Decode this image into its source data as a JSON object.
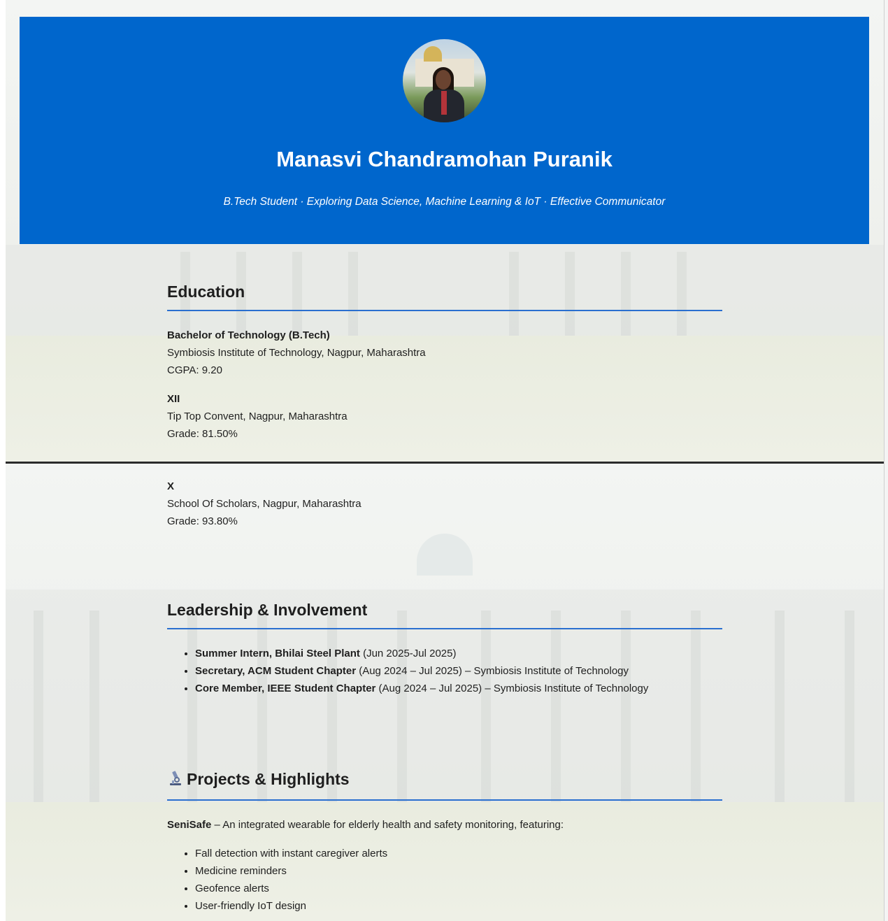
{
  "colors": {
    "hero_bg": "#0066cc",
    "section_rule": "#2a6fcf",
    "text": "#1f1f1f"
  },
  "hero": {
    "name": "Manasvi Chandramohan Puranik",
    "tagline": "B.Tech Student · Exploring Data Science, Machine Learning & IoT · Effective Communicator",
    "avatar_icon": "profile-photo"
  },
  "education": {
    "title": "Education",
    "entries": [
      {
        "degree": "Bachelor of Technology (B.Tech)",
        "institution": "Symbiosis Institute of Technology, Nagpur, Maharashtra",
        "score": "CGPA: 9.20"
      },
      {
        "degree": "XII",
        "institution": "Tip Top Convent, Nagpur, Maharashtra",
        "score": "Grade: 81.50%"
      },
      {
        "degree": "X",
        "institution": "School Of Scholars, Nagpur, Maharashtra",
        "score": "Grade: 93.80%"
      }
    ]
  },
  "leadership": {
    "title": "Leadership & Involvement",
    "items": [
      {
        "role": "Summer Intern, Bhilai Steel Plant",
        "detail": " (Jun 2025-Jul 2025)"
      },
      {
        "role": "Secretary, ACM Student Chapter",
        "detail": " (Aug 2024 – Jul 2025) – Symbiosis Institute of Technology"
      },
      {
        "role": "Core Member, IEEE Student Chapter",
        "detail": " (Aug 2024 – Jul 2025) – Symbiosis Institute of Technology"
      }
    ]
  },
  "projects": {
    "title": "Projects & Highlights",
    "title_icon": "microscope-icon",
    "project_name": "SeniSafe",
    "project_desc": " – An integrated wearable for elderly health and safety monitoring, featuring:",
    "features": [
      "Fall detection with instant caregiver alerts",
      "Medicine reminders",
      "Geofence alerts",
      "User-friendly IoT design"
    ]
  }
}
